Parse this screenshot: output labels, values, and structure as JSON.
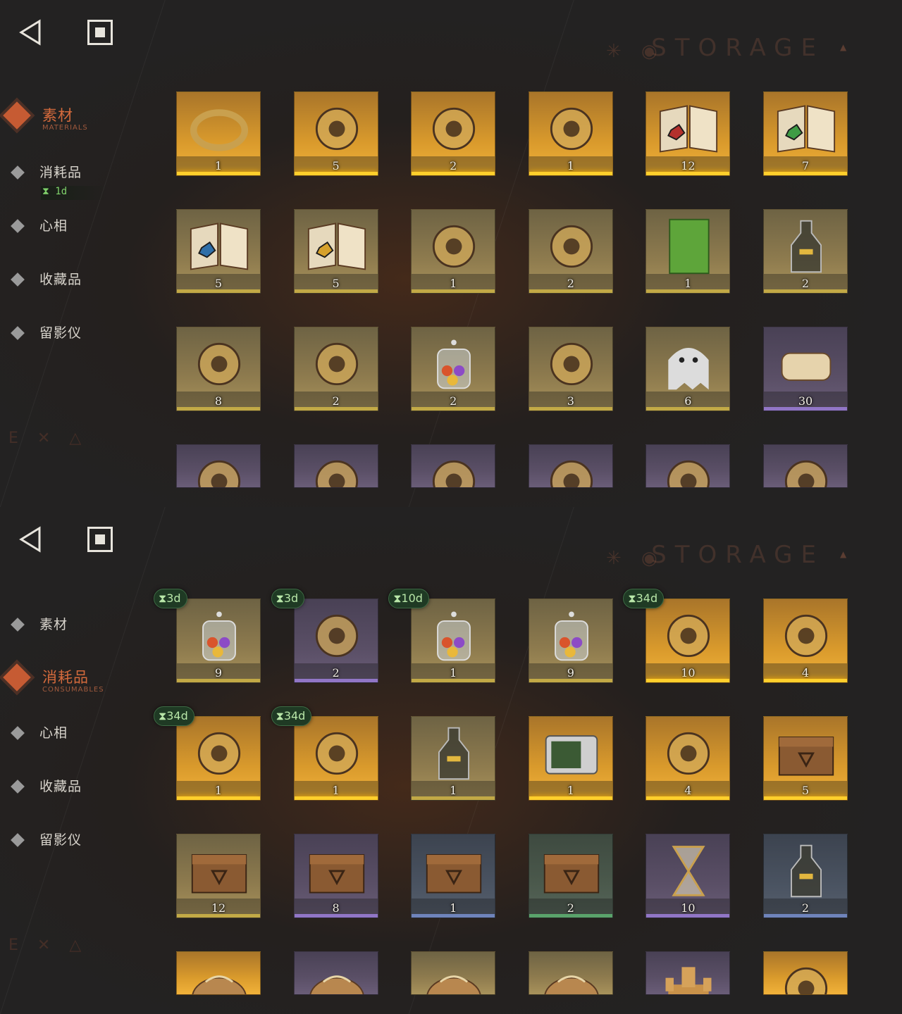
{
  "storage_label": "STORAGE",
  "corner_mark": "E ✕ △",
  "nav_items": [
    {
      "key": "materials",
      "label": "素材",
      "sub": "MATERIALS"
    },
    {
      "key": "consumables",
      "label": "消耗品",
      "sub": "CONSUMABLES"
    },
    {
      "key": "persona",
      "label": "心相"
    },
    {
      "key": "collectibles",
      "label": "收藏品"
    },
    {
      "key": "kinetoscope",
      "label": "留影仪"
    }
  ],
  "panels": [
    {
      "active_tab": "materials",
      "consumables_timer": "1d",
      "items": [
        {
          "icon": "golden-ring-icon",
          "count": "1",
          "rarity": "gold"
        },
        {
          "icon": "caduceus-icon",
          "count": "5",
          "rarity": "gold"
        },
        {
          "icon": "laurel-wreath-icon",
          "count": "2",
          "rarity": "gold"
        },
        {
          "icon": "serpent-apple-icon",
          "count": "1",
          "rarity": "gold"
        },
        {
          "icon": "red-gem-book-icon",
          "count": "12",
          "rarity": "gold"
        },
        {
          "icon": "green-gem-book-icon",
          "count": "7",
          "rarity": "gold"
        },
        {
          "icon": "blue-gem-book-icon",
          "count": "5",
          "rarity": "lgold"
        },
        {
          "icon": "yellow-gem-book-icon",
          "count": "5",
          "rarity": "lgold"
        },
        {
          "icon": "astrolabe-icon",
          "count": "1",
          "rarity": "lgold"
        },
        {
          "icon": "ouija-board-icon",
          "count": "2",
          "rarity": "lgold"
        },
        {
          "icon": "green-tablet-icon",
          "count": "1",
          "rarity": "lgold"
        },
        {
          "icon": "potion-bottle-icon",
          "count": "2",
          "rarity": "lgold"
        },
        {
          "icon": "firefly-icon",
          "count": "8",
          "rarity": "lgold"
        },
        {
          "icon": "dark-grimoire-icon",
          "count": "2",
          "rarity": "lgold"
        },
        {
          "icon": "bell-jar-icon",
          "count": "2",
          "rarity": "lgold"
        },
        {
          "icon": "hand-box-icon",
          "count": "3",
          "rarity": "lgold"
        },
        {
          "icon": "ghost-icon",
          "count": "6",
          "rarity": "lgold"
        },
        {
          "icon": "scroll-bundle-icon",
          "count": "30",
          "rarity": "purple"
        },
        {
          "icon": "amulet-icon",
          "count": "",
          "rarity": "purple"
        },
        {
          "icon": "bracelet-icon",
          "count": "",
          "rarity": "purple"
        },
        {
          "icon": "stone-fragment-icon",
          "count": "",
          "rarity": "purple"
        },
        {
          "icon": "coffin-icon",
          "count": "",
          "rarity": "purple"
        },
        {
          "icon": "clock-piece-icon",
          "count": "",
          "rarity": "purple"
        },
        {
          "icon": "winged-key-icon",
          "count": "",
          "rarity": "purple"
        }
      ]
    },
    {
      "active_tab": "consumables",
      "items": [
        {
          "icon": "candy-jar-icon",
          "count": "9",
          "rarity": "lgold",
          "timer": "3d"
        },
        {
          "icon": "lollipops-icon",
          "count": "2",
          "rarity": "purple",
          "timer": "3d"
        },
        {
          "icon": "candy-jar-icon",
          "count": "1",
          "rarity": "lgold",
          "timer": "10d"
        },
        {
          "icon": "candy-jar-icon",
          "count": "9",
          "rarity": "lgold",
          "timer": ""
        },
        {
          "icon": "orange-device-icon",
          "count": "10",
          "rarity": "gold",
          "timer": "34d"
        },
        {
          "icon": "golden-rabbit-box-icon",
          "count": "4",
          "rarity": "gold",
          "timer": ""
        },
        {
          "icon": "tailor-mannequin-icon",
          "count": "1",
          "rarity": "gold",
          "timer": "34d"
        },
        {
          "icon": "shopping-list-icon",
          "count": "1",
          "rarity": "gold",
          "timer": "34d"
        },
        {
          "icon": "message-bottle-icon",
          "count": "1",
          "rarity": "lgold",
          "timer": ""
        },
        {
          "icon": "television-icon",
          "count": "1",
          "rarity": "gold",
          "timer": ""
        },
        {
          "icon": "rune-table-icon",
          "count": "4",
          "rarity": "gold",
          "timer": ""
        },
        {
          "icon": "wooden-crate-icon",
          "count": "5",
          "rarity": "gold",
          "timer": ""
        },
        {
          "icon": "wooden-crate-icon",
          "count": "12",
          "rarity": "lgold",
          "timer": ""
        },
        {
          "icon": "wooden-crate-icon",
          "count": "8",
          "rarity": "purple",
          "timer": ""
        },
        {
          "icon": "wooden-crate-icon",
          "count": "1",
          "rarity": "blue",
          "timer": ""
        },
        {
          "icon": "wooden-crate-icon",
          "count": "2",
          "rarity": "green",
          "timer": ""
        },
        {
          "icon": "hourglass-icon",
          "count": "10",
          "rarity": "purple",
          "timer": ""
        },
        {
          "icon": "message-bottle-icon",
          "count": "2",
          "rarity": "blue",
          "timer": ""
        },
        {
          "icon": "sack-icon",
          "count": "",
          "rarity": "gold",
          "timer": ""
        },
        {
          "icon": "sack-icon",
          "count": "",
          "rarity": "purple",
          "timer": ""
        },
        {
          "icon": "sack-icon",
          "count": "",
          "rarity": "lgold",
          "timer": ""
        },
        {
          "icon": "sack-icon",
          "count": "",
          "rarity": "lgold",
          "timer": ""
        },
        {
          "icon": "castle-icon",
          "count": "",
          "rarity": "purple",
          "timer": ""
        },
        {
          "icon": "golden-frame-icon",
          "count": "",
          "rarity": "gold",
          "timer": ""
        }
      ]
    }
  ]
}
